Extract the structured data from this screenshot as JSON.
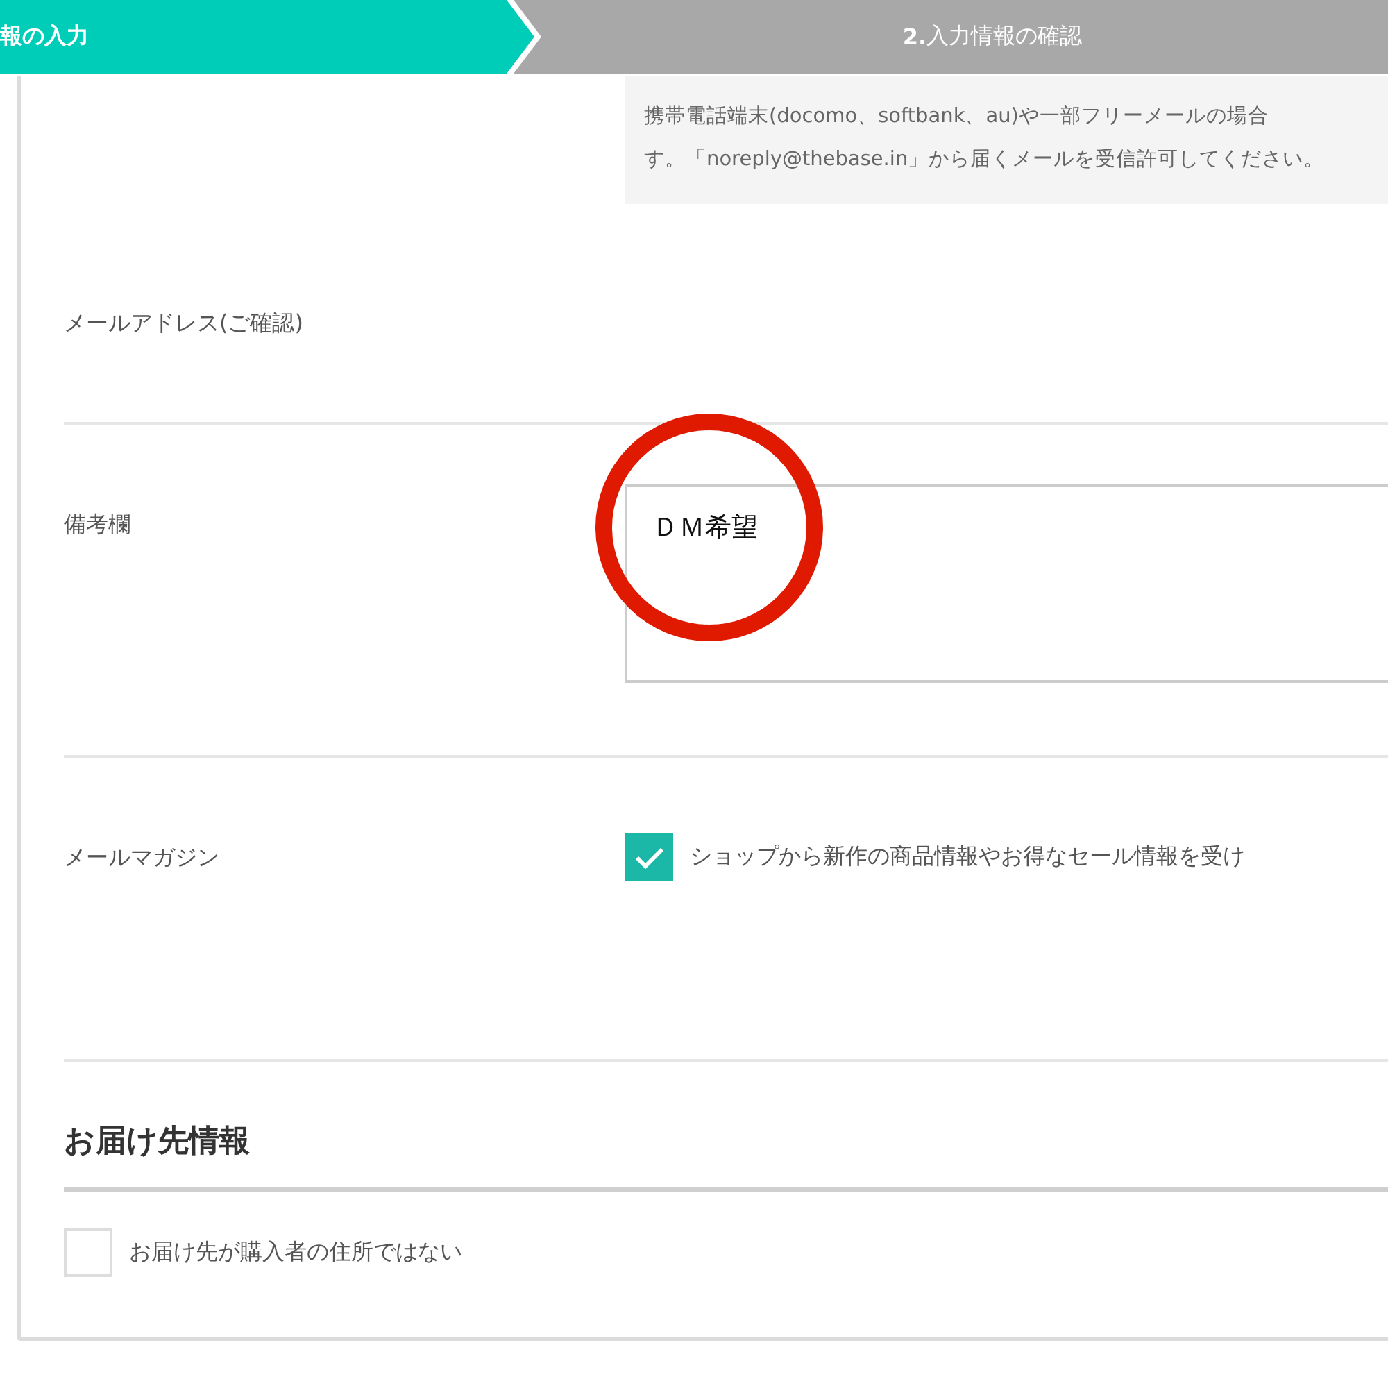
{
  "steps": [
    {
      "label": "報の入力",
      "selected": true
    },
    {
      "label": "**2.**入力情報の確認",
      "selected": false
    }
  ],
  "email_notice": [
    "携帯電話端末(docomo、softbank、au)や一部フリーメールの場合",
    "す。「noreply@thebase.in」から届くメールを受信許可してください。"
  ],
  "fields": [
    {
      "kind": "email_confirm",
      "label": "メールアドレス(ご確認)"
    },
    {
      "kind": "textarea",
      "label": "備考欄",
      "value": "ＤＭ希望",
      "circled": true
    },
    {
      "kind": "checkbox",
      "label": "メールマガジン",
      "option": "ショップから新作の商品情報やお得なセール情報を受け",
      "checked": true
    }
  ],
  "delivery": {
    "title": "お届け先情報",
    "option": "お届け先が購入者の住所ではない",
    "checked": false
  }
}
